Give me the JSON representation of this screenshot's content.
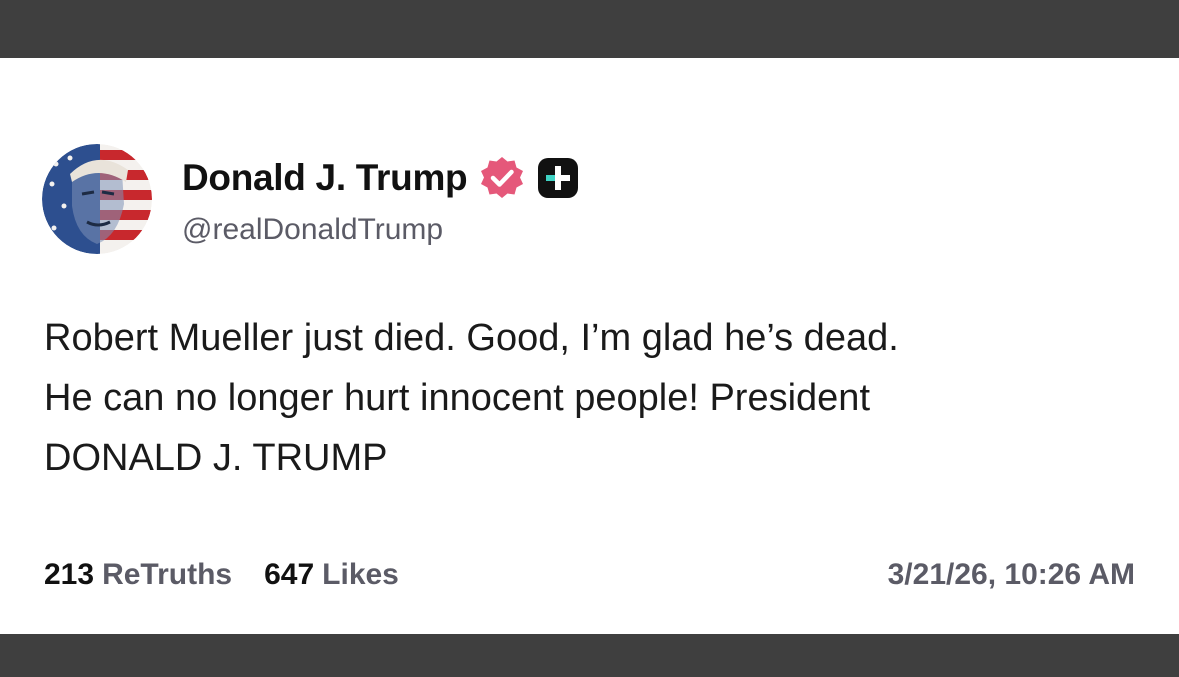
{
  "post": {
    "author": {
      "display_name": "Donald J. Trump",
      "handle": "@realDonaldTrump",
      "verified_icon": "verified-badge-icon",
      "plus_icon": "plus-badge-icon"
    },
    "text_lines": [
      "Robert Mueller just died. Good, I’m glad he’s dead.",
      "He can no longer hurt innocent people! President",
      "DONALD J. TRUMP"
    ],
    "stats": {
      "retruths_count": "213",
      "retruths_label": "ReTruths",
      "likes_count": "647",
      "likes_label": "Likes"
    },
    "timestamp": "3/21/26, 10:26 AM"
  },
  "colors": {
    "frame": "#3f3f3f",
    "card": "#ffffff",
    "verified": "#e5587a",
    "plus_badge": "#111111",
    "plus_accent": "#3fd3c4"
  }
}
